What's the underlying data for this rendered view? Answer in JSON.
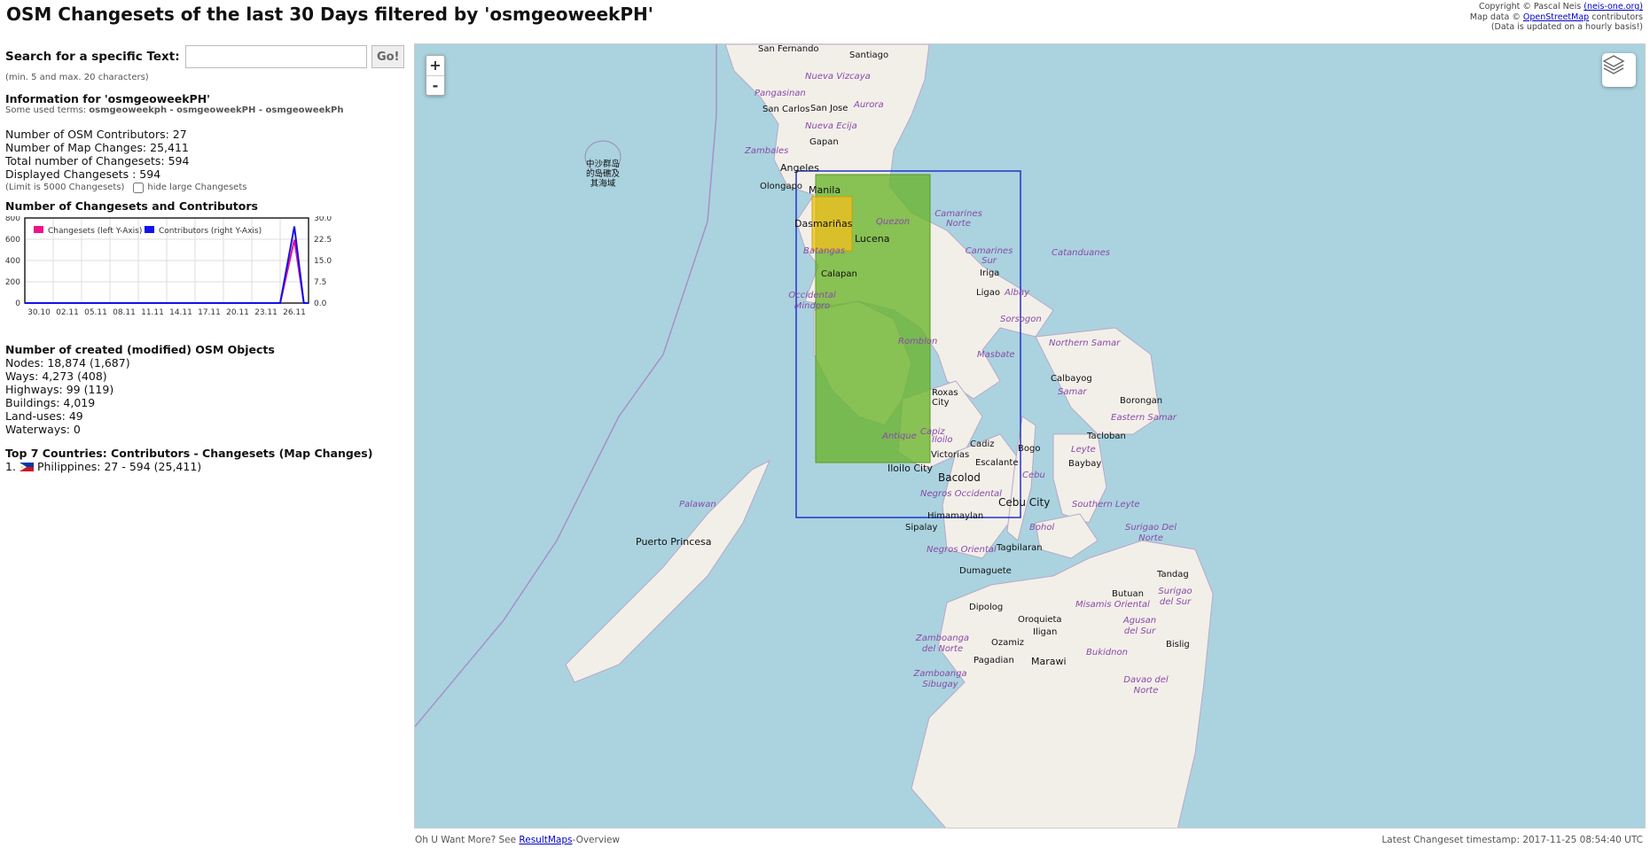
{
  "page": {
    "title": "OSM Changesets of the last 30 Days filtered by 'osmgeoweekPH'",
    "copyright": {
      "line1_prefix": "Copyright © Pascal Neis ",
      "line1_link": "(neis-one.org)",
      "line2_prefix": "Map data © ",
      "line2_link": "OpenStreetMap",
      "line2_suffix": " contributors",
      "line3": "(Data is updated on a hourly basis!)"
    }
  },
  "search": {
    "label": "Search for a specific Text:",
    "value": "",
    "placeholder": "",
    "go_label": "Go!",
    "hint": "(min. 5 and max. 20 characters)"
  },
  "info": {
    "title": "Information for 'osmgeoweekPH'",
    "terms_prefix": "Some used terms: ",
    "terms": "osmgeoweekph - osmgeoweekPH - osmgeoweekPh"
  },
  "stats": {
    "contributors": "Number of OSM Contributors: 27",
    "map_changes": "Number of Map Changes: 25,411",
    "total_changesets": "Total number of Changesets: 594",
    "displayed_changesets": "Displayed Changesets : 594",
    "limit_note": "(Limit is 5000 Changesets)",
    "hide_large_label": "hide large Changesets"
  },
  "chart_section": {
    "title": "Number of Changesets and Contributors"
  },
  "chart_data": {
    "type": "line",
    "x_ticks": [
      "30.10",
      "02.11",
      "05.11",
      "08.11",
      "11.11",
      "14.11",
      "17.11",
      "20.11",
      "23.11",
      "26.11"
    ],
    "y_left_ticks": [
      "0",
      "200",
      "400",
      "600",
      "800"
    ],
    "y_right_ticks": [
      "0.0",
      "7.5",
      "15.0",
      "22.5",
      "30.0"
    ],
    "y_left_range": [
      0,
      800
    ],
    "y_right_range": [
      0,
      30
    ],
    "x_range": [
      0,
      30
    ],
    "grid": true,
    "legend_position": "top-left",
    "series": [
      {
        "name": "Changesets (left Y-Axis)",
        "axis": "left",
        "color": "#ee1188",
        "points": [
          [
            0,
            0
          ],
          [
            27,
            0
          ],
          [
            28.5,
            594
          ],
          [
            29.5,
            0
          ],
          [
            30,
            0
          ]
        ]
      },
      {
        "name": "Contributors (right Y-Axis)",
        "axis": "right",
        "color": "#1111ee",
        "points": [
          [
            0,
            0
          ],
          [
            27,
            0
          ],
          [
            28.5,
            27
          ],
          [
            29.5,
            0
          ],
          [
            30,
            0
          ]
        ]
      }
    ]
  },
  "objects": {
    "title": "Number of created (modified) OSM Objects",
    "nodes": "Nodes: 18,874 (1,687)",
    "ways": "Ways: 4,273 (408)",
    "highways": "Highways: 99 (119)",
    "buildings": "Buildings: 4,019",
    "landuses": "Land-uses: 49",
    "waterways": "Waterways: 0"
  },
  "countries": {
    "title": "Top 7 Countries: Contributors - Changesets (Map Changes)",
    "items": [
      {
        "rank": "1.",
        "name": "Philippines: 27 - 594 (25,411)"
      }
    ]
  },
  "map": {
    "zoom_in": "+",
    "zoom_out": "-",
    "labels": {
      "san_fernando": "San Fernando",
      "santiago": "Santiago",
      "nueva_vizcaya": "Nueva Vizcaya",
      "pangasinan": "Pangasinan",
      "aurora": "Aurora",
      "san_carlos": "San Carlos",
      "san_jose": "San Jose",
      "nueva_ecija": "Nueva Ecija",
      "gapan": "Gapan",
      "zambales": "Zambales",
      "angeles": "Angeles",
      "olongapo": "Olongapo",
      "manila": "Manila",
      "dasmarinas": "Dasmariñas",
      "quezon": "Quezon",
      "lucena": "Lucena",
      "batangas": "Batangas",
      "camarines_norte": "Camarines Norte",
      "camarines_sur": "Camarines Sur",
      "catanduanes": "Catanduanes",
      "iriga": "Iriga",
      "ligao": "Ligao",
      "albay": "Albay",
      "sorsogon": "Sorsogon",
      "calapan": "Calapan",
      "occidental_mindoro": "Occidental Mindoro",
      "romblon": "Romblon",
      "masbate": "Masbate",
      "northern_samar": "Northern Samar",
      "calbayog": "Calbayog",
      "samar": "Samar",
      "borongan": "Borongan",
      "eastern_samar": "Eastern Samar",
      "tacloban": "Tacloban",
      "roxas_city": "Roxas City",
      "capiz": "Capiz",
      "antique": "Antique",
      "iloilo": "Iloilo",
      "iloilo_city": "Iloilo City",
      "cadiz": "Cadiz",
      "victorias": "Victorias",
      "bogo": "Bogo",
      "escalante": "Escalante",
      "bacolod": "Bacolod",
      "leyte": "Leyte",
      "baybay": "Baybay",
      "cebu": "Cebu",
      "cebu_city": "Cebu City",
      "negros_occidental": "Negros Occidental",
      "himamaylan": "Himamaylan",
      "southern_leyte": "Southern Leyte",
      "sipalay": "Sipalay",
      "bohol": "Bohol",
      "palawan": "Palawan",
      "puerto_princesa": "Puerto Princesa",
      "negros_oriental": "Negros Oriental",
      "tagbilaran": "Tagbilaran",
      "dumaguete": "Dumaguete",
      "surigao_del_norte": "Surigao Del Norte",
      "tandag": "Tandag",
      "butuan": "Butuan",
      "surigao_del_sur": "Surigao del Sur",
      "dipolog": "Dipolog",
      "oroquieta": "Oroquieta",
      "misamis_oriental": "Misamis Oriental",
      "agusan_del_sur": "Agusan del Sur",
      "iligan": "Iligan",
      "ozamiz": "Ozamiz",
      "bislig": "Bislig",
      "zamboanga_del_norte": "Zamboanga del Norte",
      "pagadian": "Pagadian",
      "marawi": "Marawi",
      "bukidnon": "Bukidnon",
      "zamboanga_sibugay": "Zamboanga Sibugay",
      "davao_del_norte": "Davao del Norte",
      "scarborough": "中沙群岛的岛礁及其海域"
    }
  },
  "footer": {
    "left_prefix": "Oh U Want More? See ",
    "left_link": "ResultMaps",
    "left_suffix": "-Overview",
    "right": "Latest Changeset timestamp: 2017-11-25 08:54:40 UTC"
  }
}
